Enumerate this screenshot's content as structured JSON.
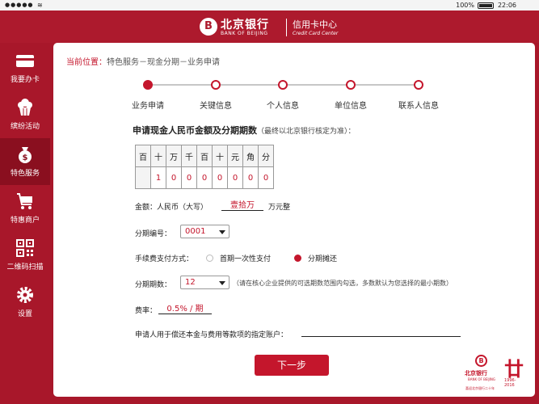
{
  "statusbar": {
    "signal": "●●●●●",
    "battery": "100%",
    "time": "22:06"
  },
  "header": {
    "logo_mark": "B",
    "bank_name_cn": "北京银行",
    "bank_name_en": "BANK OF BEIJING",
    "center_cn": "信用卡中心",
    "center_en": "Credit Card Center"
  },
  "sidebar": {
    "items": [
      {
        "label": "我要办卡",
        "icon": "card-icon"
      },
      {
        "label": "缤纷活动",
        "icon": "cupcake-icon"
      },
      {
        "label": "特色服务",
        "icon": "money-bag-icon"
      },
      {
        "label": "特惠商户",
        "icon": "cart-icon"
      },
      {
        "label": "二维码扫描",
        "icon": "qrcode-icon"
      },
      {
        "label": "设置",
        "icon": "gear-icon"
      }
    ]
  },
  "breadcrumb": {
    "label": "当前位置：",
    "path": "特色服务－现金分期－业务申请"
  },
  "steps": [
    "业务申请",
    "关键信息",
    "个人信息",
    "单位信息",
    "联系人信息"
  ],
  "form": {
    "title": "申请现金人民币金额及分期期数",
    "title_note": "（最终以北京银行核定为准）：",
    "digit_headers": [
      "百",
      "十",
      "万",
      "千",
      "百",
      "十",
      "元",
      "角",
      "分"
    ],
    "digit_values": [
      "",
      "1",
      "0",
      "0",
      "0",
      "0",
      "0",
      "0",
      "0",
      "0"
    ],
    "amount_label": "金额：人民币（大写）",
    "amount_value": "壹拾万",
    "amount_suffix": "万元整",
    "installment_no_label": "分期编号：",
    "installment_no_value": "0001",
    "fee_label": "手续费支付方式：",
    "fee_option_1": "首期一次性支付",
    "fee_option_2": "分期摊还",
    "periods_label": "分期期数：",
    "periods_value": "12",
    "periods_note": "（请在核心企业提供的可选期数范围内勾选，多数默认为您选择的最小期数）",
    "rate_label": "费率：",
    "rate_value": "0.5% / 期",
    "account_label": "申请人用于偿还本金与费用等款项的指定账户："
  },
  "next_button": "下一步",
  "brand_footer": {
    "mark": "B",
    "name": "北京银行",
    "en": "BANK OF BEIJING",
    "anniv_glyph": "廿",
    "anniv_years": "1996-2016",
    "tagline": "喜迎北京银行二十年"
  }
}
